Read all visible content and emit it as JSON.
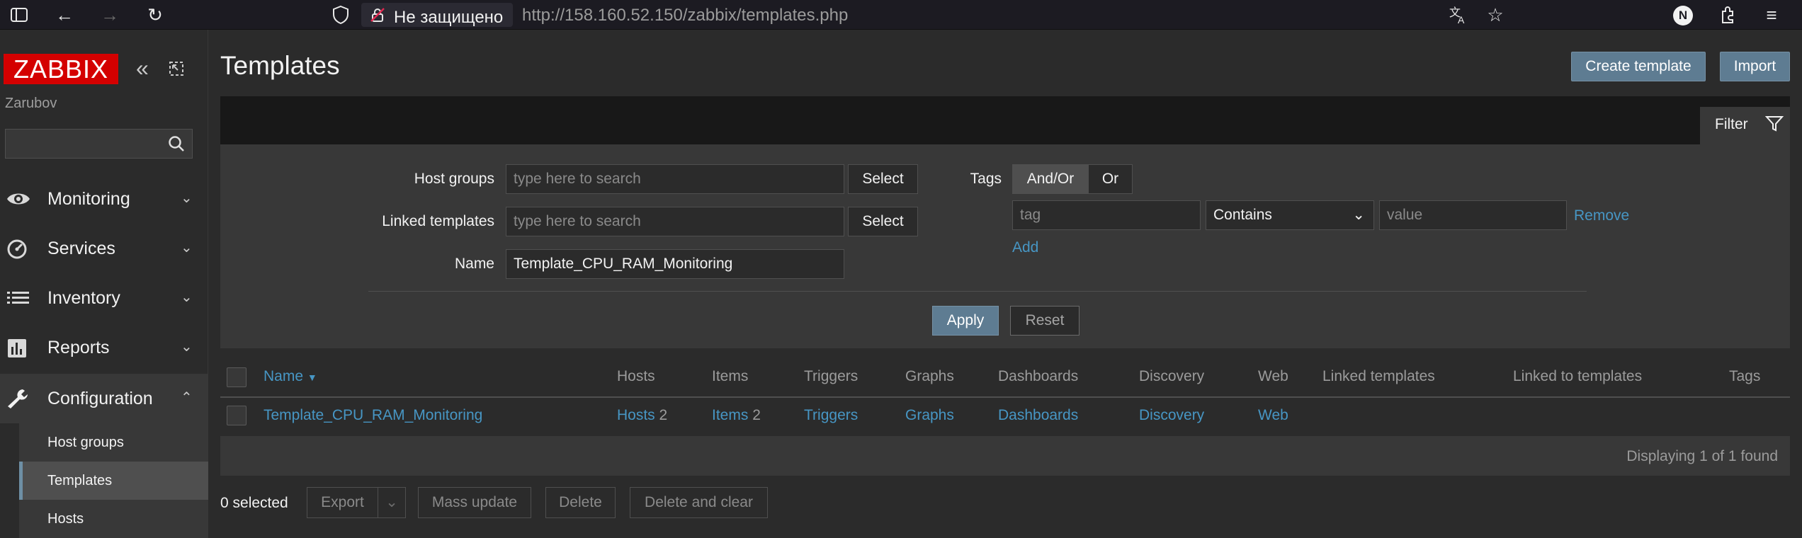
{
  "browser": {
    "security_label": "Не защищено",
    "url_host": "http://158.160.52.150",
    "url_path": "/zabbix/templates.php",
    "account_initial": "N"
  },
  "sidebar": {
    "logo": "ZABBIX",
    "username": "Zarubov",
    "search_placeholder": "",
    "menu": [
      {
        "label": "Monitoring",
        "icon": "eye-icon"
      },
      {
        "label": "Services",
        "icon": "gauge-icon"
      },
      {
        "label": "Inventory",
        "icon": "list-icon"
      },
      {
        "label": "Reports",
        "icon": "bar-chart-icon"
      },
      {
        "label": "Configuration",
        "icon": "wrench-icon"
      }
    ],
    "submenu": [
      "Host groups",
      "Templates",
      "Hosts"
    ]
  },
  "header": {
    "title": "Templates",
    "create_label": "Create template",
    "import_label": "Import"
  },
  "filter": {
    "tab_label": "Filter",
    "host_groups_label": "Host groups",
    "host_groups_placeholder": "type here to search",
    "linked_templates_label": "Linked templates",
    "linked_templates_placeholder": "type here to search",
    "select_label": "Select",
    "name_label": "Name",
    "name_value": "Template_CPU_RAM_Monitoring",
    "tags_label": "Tags",
    "andor_label": "And/Or",
    "or_label": "Or",
    "tag_placeholder": "tag",
    "operator_value": "Contains",
    "value_placeholder": "value",
    "remove_label": "Remove",
    "add_label": "Add",
    "apply_label": "Apply",
    "reset_label": "Reset"
  },
  "table": {
    "columns": [
      "Name",
      "Hosts",
      "Items",
      "Triggers",
      "Graphs",
      "Dashboards",
      "Discovery",
      "Web",
      "Linked templates",
      "Linked to templates",
      "Tags"
    ],
    "rows": [
      {
        "name": "Template_CPU_RAM_Monitoring",
        "hosts": "Hosts",
        "hosts_count": "2",
        "items": "Items",
        "items_count": "2",
        "triggers": "Triggers",
        "graphs": "Graphs",
        "dashboards": "Dashboards",
        "discovery": "Discovery",
        "web": "Web"
      }
    ],
    "footer": "Displaying 1 of 1 found"
  },
  "actions": {
    "selected": "0 selected",
    "export": "Export",
    "mass_update": "Mass update",
    "delete": "Delete",
    "delete_clear": "Delete and clear"
  },
  "colors": {
    "accent": "#5e7c92",
    "link": "#4796c4",
    "logo": "#d40000"
  }
}
